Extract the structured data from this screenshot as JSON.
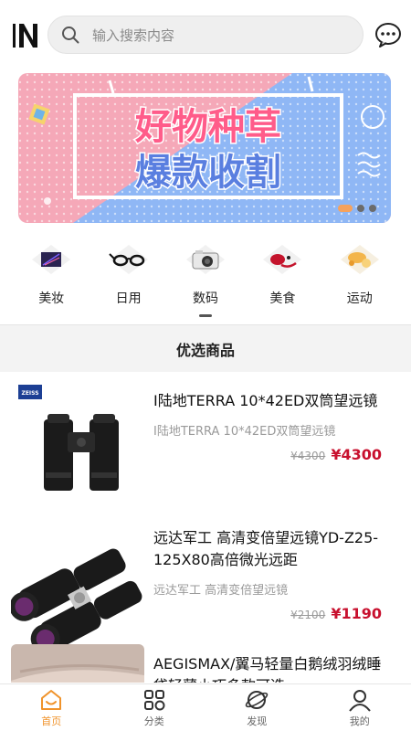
{
  "header": {
    "search_placeholder": "输入搜索内容"
  },
  "banner": {
    "line1": "好物种草",
    "line2": "爆款收割",
    "slides": 3,
    "active_slide": 1
  },
  "categories": [
    {
      "label": "美妆",
      "icon": "makeup-palette-icon"
    },
    {
      "label": "日用",
      "icon": "glasses-icon"
    },
    {
      "label": "数码",
      "icon": "camera-icon"
    },
    {
      "label": "美食",
      "icon": "food-icon"
    },
    {
      "label": "运动",
      "icon": "sports-icon"
    }
  ],
  "section_title": "优选商品",
  "products": [
    {
      "brand": "ZEISS",
      "title": "I陆地TERRA 10*42ED双筒望远镜",
      "subtitle": "I陆地TERRA 10*42ED双筒望远镜",
      "old_price": "¥4300",
      "price": "¥4300"
    },
    {
      "title": "远达军工 高清变倍望远镜YD-Z25-125X80高倍微光远距",
      "subtitle": "远达军工 高清变倍望远镜",
      "old_price": "¥2100",
      "price": "¥1190"
    },
    {
      "title": "AEGISMAX/翼马轻量白鹅绒羽绒睡袋轻薄小巧多款可选",
      "subtitle": "",
      "old_price": "",
      "price": ""
    }
  ],
  "tabs": [
    {
      "label": "首页",
      "icon": "home-icon",
      "active": true
    },
    {
      "label": "分类",
      "icon": "category-grid-icon",
      "active": false
    },
    {
      "label": "发现",
      "icon": "discover-planet-icon",
      "active": false
    },
    {
      "label": "我的",
      "icon": "profile-icon",
      "active": false
    }
  ],
  "colors": {
    "accent": "#f0932b",
    "price_red": "#c8102e",
    "banner_pink": "#f5a8b8",
    "banner_blue": "#8fb7f5"
  }
}
